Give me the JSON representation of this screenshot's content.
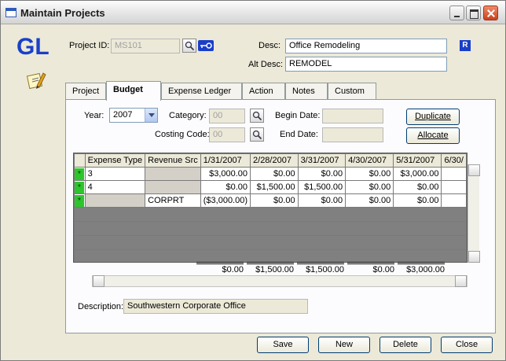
{
  "window": {
    "title": "Maintain Projects"
  },
  "logo": {
    "text": "GL",
    "color": "#1a3fc9"
  },
  "header": {
    "project_id_label": "Project ID:",
    "project_id_value": "MS101",
    "desc_label": "Desc:",
    "desc_value": "Office Remodeling",
    "alt_desc_label": "Alt Desc:",
    "alt_desc_value": "REMODEL",
    "r_badge": "R"
  },
  "tabs": [
    {
      "label": "Project",
      "active": false
    },
    {
      "label": "Budget",
      "active": true
    },
    {
      "label": "Expense Ledger",
      "active": false
    },
    {
      "label": "Action",
      "active": false
    },
    {
      "label": "Notes",
      "active": false
    },
    {
      "label": "Custom",
      "active": false
    }
  ],
  "budget": {
    "year_label": "Year:",
    "year_value": "2007",
    "category_label": "Category:",
    "category_value": "00",
    "costing_code_label": "Costing Code:",
    "costing_code_value": "00",
    "begin_date_label": "Begin Date:",
    "begin_date_value": "",
    "end_date_label": "End Date:",
    "end_date_value": "",
    "duplicate_label": "Duplicate",
    "allocate_label": "Allocate"
  },
  "grid": {
    "columns": [
      "Expense Type",
      "Revenue Src",
      "1/31/2007",
      "2/28/2007",
      "3/31/2007",
      "4/30/2007",
      "5/31/2007",
      "6/30/"
    ],
    "rows": [
      {
        "marker": "*",
        "cells": [
          "3",
          "",
          "$3,000.00",
          "$0.00",
          "$0.00",
          "$0.00",
          "$3,000.00",
          ""
        ]
      },
      {
        "marker": "*",
        "cells": [
          "4",
          "",
          "$0.00",
          "$1,500.00",
          "$1,500.00",
          "$0.00",
          "$0.00",
          ""
        ]
      },
      {
        "marker": "*",
        "cells": [
          "",
          "CORPRT",
          "($3,000.00)",
          "$0.00",
          "$0.00",
          "$0.00",
          "$0.00",
          ""
        ]
      }
    ],
    "totals": [
      "$0.00",
      "$1,500.00",
      "$1,500.00",
      "$0.00",
      "$3,000.00"
    ]
  },
  "description": {
    "label": "Description:",
    "value": "Southwestern Corporate Office"
  },
  "buttons": {
    "save": "Save",
    "new": "New",
    "delete": "Delete",
    "close": "Close"
  }
}
